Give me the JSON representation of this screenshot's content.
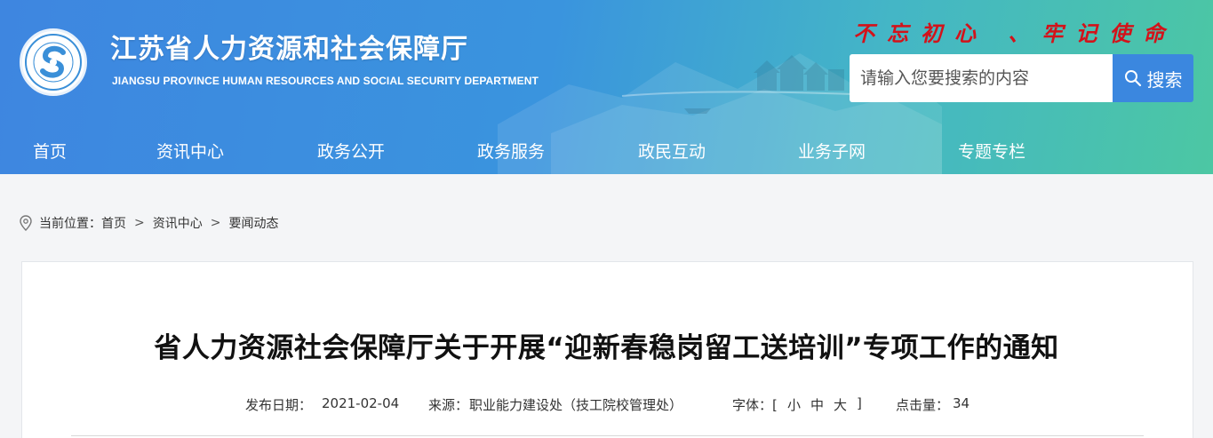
{
  "header": {
    "title": "江苏省人力资源和社会保障厅",
    "subtitle": "JIANGSU PROVINCE HUMAN RESOURCES AND SOCIAL SECURITY DEPARTMENT",
    "slogan": "不忘初心 、牢记使命",
    "search": {
      "placeholder": "请输入您要搜索的内容",
      "button_label": "搜索"
    },
    "colors": {
      "gradient_start": "#3e86e0",
      "gradient_end": "#4cc7a3",
      "slogan": "#d3121a",
      "search_button": "#3b87df"
    }
  },
  "nav": {
    "items": [
      "首页",
      "资讯中心",
      "政务公开",
      "政务服务",
      "政民互动",
      "业务子网",
      "专题专栏"
    ]
  },
  "breadcrumb": {
    "prefix": "当前位置：",
    "items": [
      "首页",
      "资讯中心",
      "要闻动态"
    ],
    "separator": ">"
  },
  "article": {
    "title": "省人力资源社会保障厅关于开展“迎新春稳岗留工送培训”专项工作的通知",
    "publish_label": "发布日期：",
    "publish_date": "2021-02-04",
    "source_label": "来源：",
    "source": "职业能力建设处（技工院校管理处）",
    "font_label": "字体：[",
    "font_small": "小",
    "font_medium": "中",
    "font_large": "大",
    "font_close": "]",
    "hits_label": "点击量：",
    "hits": "34"
  }
}
